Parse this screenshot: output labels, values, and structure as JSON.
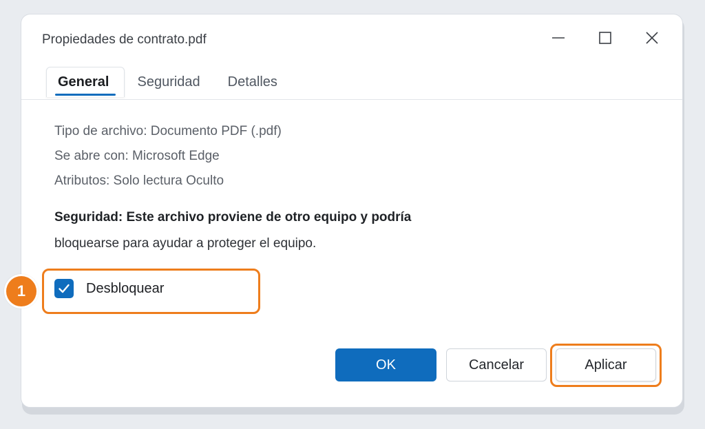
{
  "window": {
    "title": "Propiedades de contrato.pdf",
    "controls": {
      "minimize_icon": "minimize-icon",
      "maximize_icon": "maximize-icon",
      "close_icon": "close-icon"
    }
  },
  "tabs": [
    {
      "label": "General",
      "active": true
    },
    {
      "label": "Seguridad",
      "active": false
    },
    {
      "label": "Detalles",
      "active": false
    }
  ],
  "info": {
    "file_type": "Tipo de archivo: Documento PDF (.pdf)",
    "opens_with": "Se abre con: Microsoft Edge",
    "attributes": "Atributos: Solo lectura Oculto"
  },
  "security": {
    "title": "Seguridad: Este archivo proviene de otro equipo y podría",
    "description": "bloquearse para ayudar a proteger el equipo."
  },
  "unblock": {
    "label": "Desbloquear",
    "checked": true
  },
  "step_badge": "1",
  "buttons": {
    "ok": "OK",
    "cancel": "Cancelar",
    "apply": "Aplicar"
  },
  "colors": {
    "accent": "#0f6cbd",
    "highlight": "#ee7d1c",
    "background": "#e9ecf0"
  }
}
